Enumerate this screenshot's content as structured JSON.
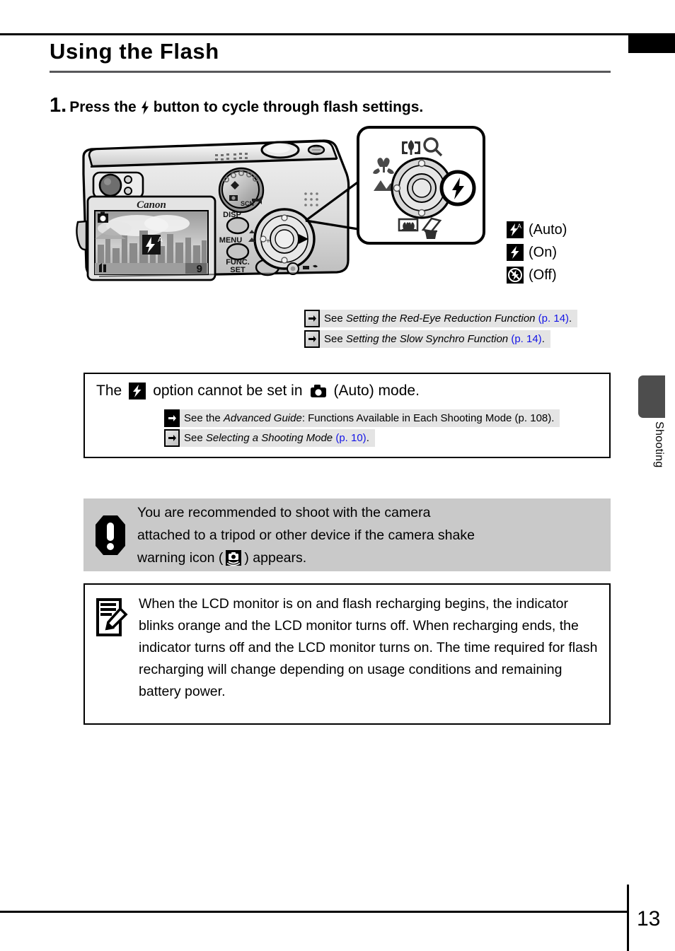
{
  "document": {
    "title": "Using the Flash",
    "page_number": "13",
    "side_tab_label": "Shooting"
  },
  "step": {
    "number": "1.",
    "text_before": "Press the",
    "icon": "flash-bolt-icon",
    "text_after": "button to cycle through flash settings."
  },
  "camera_illustration": {
    "brand": "Canon",
    "lcd": {
      "mode_icon": "camera-auto-icon",
      "flash_overlay_icon": "flash-auto-icon",
      "quality_icon": "image-quality-icon",
      "shots_remaining": "9"
    },
    "buttons": [
      {
        "label": "DISP"
      },
      {
        "label": "MENU"
      },
      {
        "label": "FUNC. SET",
        "line1": "FUNC.",
        "line2": "SET"
      }
    ],
    "mode_dial": "mode-dial",
    "print_share_icon": "print-share-icon"
  },
  "zoom_callout": {
    "icons": {
      "top": "tele-zoom-icon",
      "top_right": "magnifier-icon",
      "left_upper": "macro-flower-icon",
      "left_lower": "infinity-landscape-icon",
      "right": "flash-bolt-icon",
      "bottom_left": "wide-zoom-icon",
      "bottom_right": "delete-trash-icon"
    },
    "highlighted": "flash-bolt-icon"
  },
  "flash_legend": [
    {
      "icon": "flash-auto-icon",
      "label": "(Auto)"
    },
    {
      "icon": "flash-on-icon",
      "label": "(On)"
    },
    {
      "icon": "flash-off-icon",
      "label": "(Off)"
    }
  ],
  "references_top": [
    {
      "arrow_style": "gray",
      "prefix": "See ",
      "italic": "Setting the Red-Eye Reduction Function",
      "page": " (p. 14)",
      "suffix": "."
    },
    {
      "arrow_style": "gray",
      "prefix": "See ",
      "italic": "Setting the Slow Synchro Function",
      "page": " (p. 14)",
      "suffix": "."
    }
  ],
  "info_box": {
    "text_1": "The",
    "icon_1": "flash-on-icon",
    "text_2": "option cannot be set in",
    "icon_2": "camera-auto-icon",
    "text_3": "(Auto) mode.",
    "references": [
      {
        "arrow_style": "solid",
        "prefix": "See the ",
        "italic": "Advanced Guide",
        "after_italic": ": Functions Available in Each Shooting Mode (p. 108).",
        "page": "",
        "suffix": ""
      },
      {
        "arrow_style": "gray",
        "prefix": "See ",
        "italic": "Selecting a Shooting Mode",
        "after_italic": "",
        "page": " (p. 10)",
        "suffix": "."
      }
    ]
  },
  "caution_box": {
    "icon": "exclamation-octagon-icon",
    "line_1": "You are recommended to shoot with the camera",
    "line_2": "attached to a tripod or other device if the camera shake",
    "line_3_before": "warning icon (",
    "inline_icon": "camera-shake-icon",
    "line_3_after": ") appears."
  },
  "note_box": {
    "icon": "note-pencil-icon",
    "text": "When the LCD monitor is on and flash recharging begins, the indicator blinks orange and the LCD monitor turns off. When recharging ends, the indicator turns off and the LCD monitor turns on. The time required for flash recharging will change depending on usage conditions and remaining battery power."
  },
  "colors": {
    "link_blue": "#1414e6",
    "rule_gray": "#58585a",
    "caution_bg": "#c9c9c9",
    "xref_bg": "#e4e4e4",
    "tab_gray": "#4d4d4d"
  }
}
